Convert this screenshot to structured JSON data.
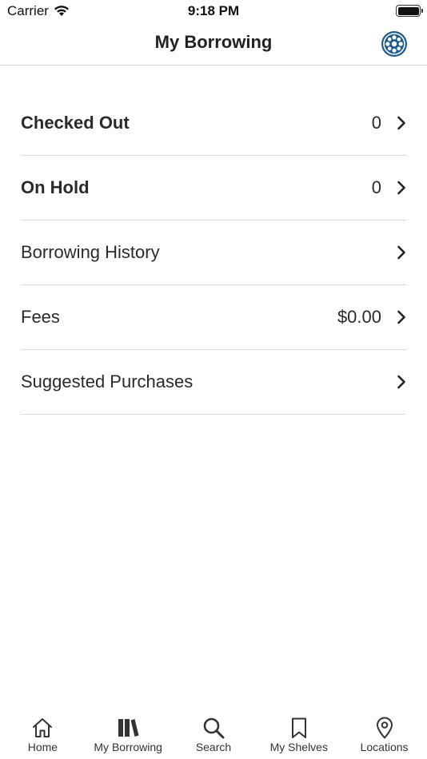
{
  "status_bar": {
    "carrier": "Carrier",
    "time": "9:18 PM"
  },
  "nav": {
    "title": "My Borrowing",
    "logo_icon": "library-logo-icon"
  },
  "rows": [
    {
      "label": "Checked Out",
      "count": "0",
      "bold": true
    },
    {
      "label": "On Hold",
      "count": "0",
      "bold": true
    },
    {
      "label": "Borrowing History",
      "count": "",
      "bold": false
    },
    {
      "label": "Fees",
      "count": "$0.00",
      "bold": false
    },
    {
      "label": "Suggested Purchases",
      "count": "",
      "bold": false
    }
  ],
  "tabs": [
    {
      "label": "Home",
      "icon": "home-icon"
    },
    {
      "label": "My Borrowing",
      "icon": "books-icon"
    },
    {
      "label": "Search",
      "icon": "search-icon"
    },
    {
      "label": "My Shelves",
      "icon": "bookmark-icon"
    },
    {
      "label": "Locations",
      "icon": "map-pin-icon"
    }
  ],
  "colors": {
    "logo_blue": "#1f5a8c",
    "text": "#222222",
    "divider": "#d9d9d9"
  }
}
